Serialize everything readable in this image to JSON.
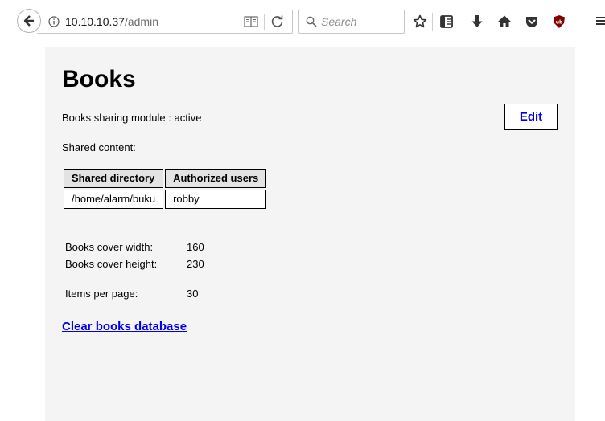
{
  "browser": {
    "url_host": "10.10.10.37",
    "url_path": "/admin",
    "search_placeholder": "Search",
    "icons": [
      "back-arrow-icon",
      "info-icon",
      "reader-view-icon",
      "reload-icon",
      "search-icon",
      "bookmark-star-icon",
      "bookmarks-library-icon",
      "downloads-icon",
      "home-icon",
      "pocket-icon",
      "ublock-icon",
      "menu-icon"
    ]
  },
  "page": {
    "title": "Books",
    "status_text": "Books sharing module : active",
    "edit_label": "Edit",
    "shared_label": "Shared content:",
    "table": {
      "headers": [
        "Shared directory",
        "Authorized users"
      ],
      "rows": [
        [
          "/home/alarm/buku",
          "robby"
        ]
      ]
    },
    "settings": [
      {
        "label": "Books cover width:",
        "value": "160"
      },
      {
        "label": "Books cover height:",
        "value": "230"
      },
      {
        "label": "Items per page:",
        "value": "30"
      }
    ],
    "clear_link": "Clear books database"
  },
  "colors": {
    "link": "#0000ee",
    "panel_bg": "#f4f4f4",
    "header_bg": "#e3e3e3",
    "ublock_red": "#800000"
  }
}
